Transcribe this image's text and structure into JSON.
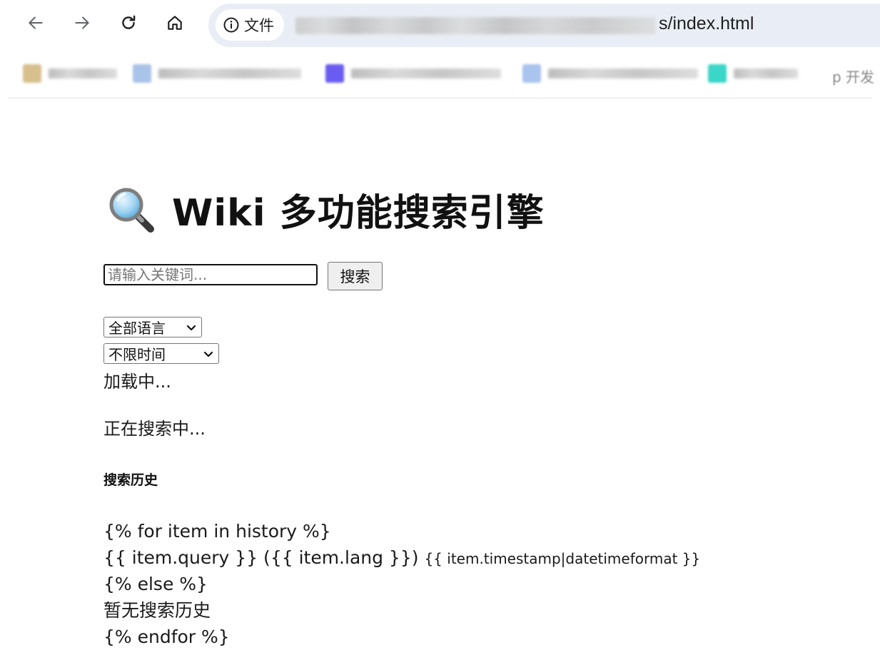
{
  "browser": {
    "site_chip_label": "文件",
    "url_visible_suffix": "s/index.html",
    "bookmarks_visible_tail": "p 开发",
    "icons": [
      "back-arrow-icon",
      "forward-arrow-icon",
      "reload-icon",
      "home-icon",
      "info-icon"
    ],
    "bookmark_icon_colors": [
      "#d8c08e",
      "#a9c4e8",
      "#6a5cf0",
      "#a9c4ee",
      "#3ad6c8"
    ]
  },
  "page": {
    "title": "Wiki 多功能搜索引擎",
    "title_icon": "magnifier-icon",
    "search": {
      "placeholder": "请输入关键词...",
      "value": "",
      "button_label": "搜索"
    },
    "language_select": {
      "selected": "全部语言"
    },
    "time_select": {
      "selected": "不限时间"
    },
    "loading_text": "加载中...",
    "searching_text": "正在搜索中...",
    "history": {
      "heading": "搜索历史",
      "template_lines": {
        "for_open": "{% for item in history %}",
        "item_main": "{{ item.query }} ({{ item.lang }})",
        "item_time": "{{ item.timestamp|datetimeformat }}",
        "else_tag": "{% else %}",
        "empty_text": "暂无搜索历史",
        "endfor": "{% endfor %}"
      }
    }
  }
}
